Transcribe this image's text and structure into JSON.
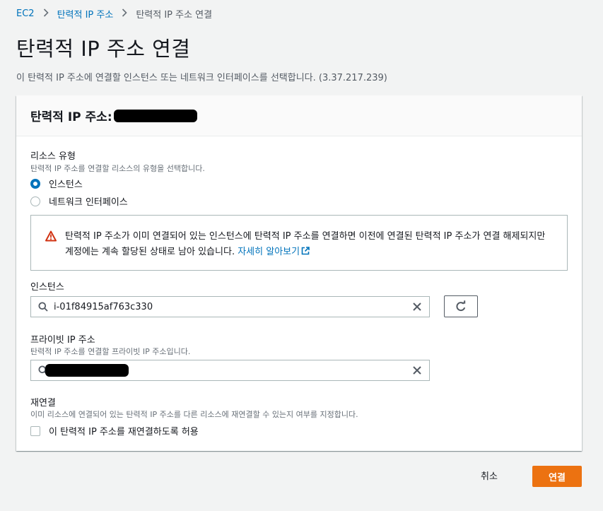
{
  "breadcrumb": {
    "items": [
      "EC2",
      "탄력적 IP 주소",
      "탄력적 IP 주소 연결"
    ]
  },
  "page": {
    "title": "탄력적 IP 주소 연결",
    "description": "이 탄력적 IP 주소에 연결할 인스턴스 또는 네트워크 인터페이스를 선택합니다. (3.37.217.239)"
  },
  "panel": {
    "header": "탄력적 IP 주소:"
  },
  "resource_type": {
    "label": "리소스 유형",
    "sublabel": "탄력적 IP 주소를 연결할 리소스의 유형을 선택합니다.",
    "options": [
      {
        "label": "인스턴스",
        "selected": true
      },
      {
        "label": "네트워크 인터페이스",
        "selected": false
      }
    ]
  },
  "alert": {
    "text": "탄력적 IP 주소가 이미 연결되어 있는 인스턴스에 탄력적 IP 주소를 연결하면 이전에 연결된 탄력적 IP 주소가 연결 해제되지만 계정에는 계속 할당된 상태로 남아 있습니다.",
    "link": "자세히 알아보기",
    "color": "#d13212"
  },
  "instance": {
    "label": "인스턴스",
    "value": "i-01f84915af763c330"
  },
  "private_ip": {
    "label": "프라이빗 IP 주소",
    "sublabel": "탄력적 IP 주소를 연결할 프라이빗 IP 주소입니다."
  },
  "reassociate": {
    "label": "재연결",
    "sublabel": "이미 리소스에 연결되어 있는 탄력적 IP 주소를 다른 리소스에 재연결할 수 있는지 여부를 지정합니다.",
    "checkbox_label": "이 탄력적 IP 주소를 재연결하도록 허용",
    "checked": false
  },
  "footer": {
    "cancel": "취소",
    "submit": "연결"
  },
  "colors": {
    "link": "#0073bb",
    "primary": "#ec7211"
  }
}
